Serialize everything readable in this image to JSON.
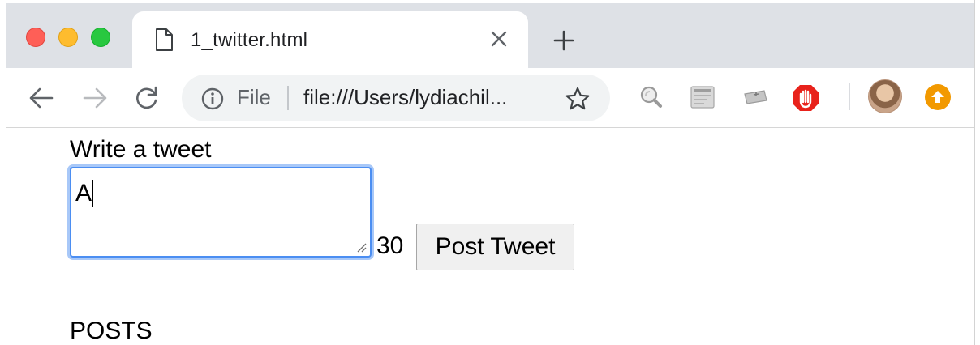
{
  "browser": {
    "tab": {
      "title": "1_twitter.html"
    },
    "address_bar": {
      "security_chip": "File",
      "url": "file:///Users/lydiachil..."
    },
    "icons": {
      "back": "arrow-left-icon",
      "forward": "arrow-right-icon",
      "reload": "reload-icon",
      "info": "info-icon",
      "bookmark": "star-icon",
      "extensions": [
        "magnifier-extension-icon",
        "smtp-extension-icon",
        "keyboard-extension-icon",
        "adblock-hand-icon"
      ],
      "profile": "avatar",
      "update": "update-arrow-icon"
    }
  },
  "page": {
    "compose": {
      "label": "Write a tweet",
      "input_value": "A",
      "char_count": "30",
      "submit_label": "Post Tweet"
    },
    "posts": {
      "heading": "POSTS"
    }
  },
  "colors": {
    "tabstrip": "#dee1e6",
    "focus_ring": "#4b8ef2",
    "adblock": "#e8221b",
    "update_badge": "#f29900"
  }
}
